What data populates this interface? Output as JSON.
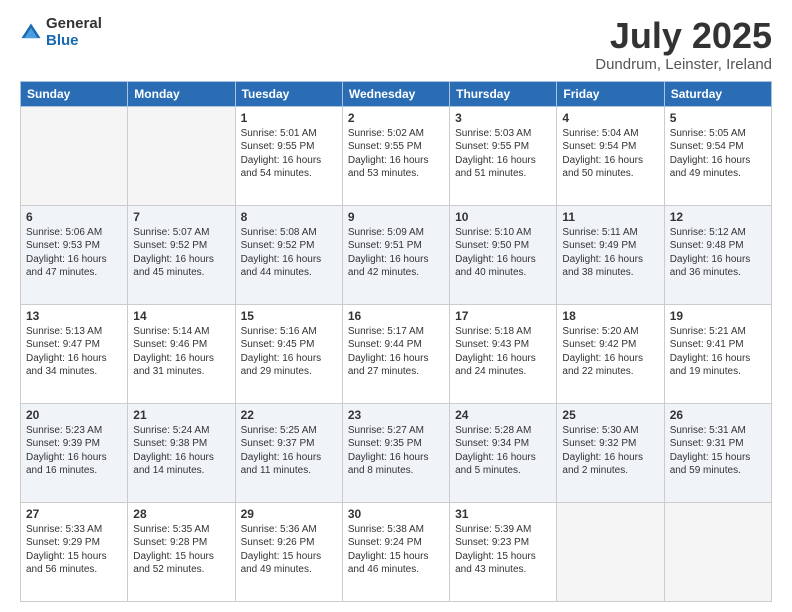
{
  "logo": {
    "general": "General",
    "blue": "Blue"
  },
  "title": "July 2025",
  "subtitle": "Dundrum, Leinster, Ireland",
  "weekdays": [
    "Sunday",
    "Monday",
    "Tuesday",
    "Wednesday",
    "Thursday",
    "Friday",
    "Saturday"
  ],
  "weeks": [
    [
      {
        "day": "",
        "info": ""
      },
      {
        "day": "",
        "info": ""
      },
      {
        "day": "1",
        "info": "Sunrise: 5:01 AM\nSunset: 9:55 PM\nDaylight: 16 hours\nand 54 minutes."
      },
      {
        "day": "2",
        "info": "Sunrise: 5:02 AM\nSunset: 9:55 PM\nDaylight: 16 hours\nand 53 minutes."
      },
      {
        "day": "3",
        "info": "Sunrise: 5:03 AM\nSunset: 9:55 PM\nDaylight: 16 hours\nand 51 minutes."
      },
      {
        "day": "4",
        "info": "Sunrise: 5:04 AM\nSunset: 9:54 PM\nDaylight: 16 hours\nand 50 minutes."
      },
      {
        "day": "5",
        "info": "Sunrise: 5:05 AM\nSunset: 9:54 PM\nDaylight: 16 hours\nand 49 minutes."
      }
    ],
    [
      {
        "day": "6",
        "info": "Sunrise: 5:06 AM\nSunset: 9:53 PM\nDaylight: 16 hours\nand 47 minutes."
      },
      {
        "day": "7",
        "info": "Sunrise: 5:07 AM\nSunset: 9:52 PM\nDaylight: 16 hours\nand 45 minutes."
      },
      {
        "day": "8",
        "info": "Sunrise: 5:08 AM\nSunset: 9:52 PM\nDaylight: 16 hours\nand 44 minutes."
      },
      {
        "day": "9",
        "info": "Sunrise: 5:09 AM\nSunset: 9:51 PM\nDaylight: 16 hours\nand 42 minutes."
      },
      {
        "day": "10",
        "info": "Sunrise: 5:10 AM\nSunset: 9:50 PM\nDaylight: 16 hours\nand 40 minutes."
      },
      {
        "day": "11",
        "info": "Sunrise: 5:11 AM\nSunset: 9:49 PM\nDaylight: 16 hours\nand 38 minutes."
      },
      {
        "day": "12",
        "info": "Sunrise: 5:12 AM\nSunset: 9:48 PM\nDaylight: 16 hours\nand 36 minutes."
      }
    ],
    [
      {
        "day": "13",
        "info": "Sunrise: 5:13 AM\nSunset: 9:47 PM\nDaylight: 16 hours\nand 34 minutes."
      },
      {
        "day": "14",
        "info": "Sunrise: 5:14 AM\nSunset: 9:46 PM\nDaylight: 16 hours\nand 31 minutes."
      },
      {
        "day": "15",
        "info": "Sunrise: 5:16 AM\nSunset: 9:45 PM\nDaylight: 16 hours\nand 29 minutes."
      },
      {
        "day": "16",
        "info": "Sunrise: 5:17 AM\nSunset: 9:44 PM\nDaylight: 16 hours\nand 27 minutes."
      },
      {
        "day": "17",
        "info": "Sunrise: 5:18 AM\nSunset: 9:43 PM\nDaylight: 16 hours\nand 24 minutes."
      },
      {
        "day": "18",
        "info": "Sunrise: 5:20 AM\nSunset: 9:42 PM\nDaylight: 16 hours\nand 22 minutes."
      },
      {
        "day": "19",
        "info": "Sunrise: 5:21 AM\nSunset: 9:41 PM\nDaylight: 16 hours\nand 19 minutes."
      }
    ],
    [
      {
        "day": "20",
        "info": "Sunrise: 5:23 AM\nSunset: 9:39 PM\nDaylight: 16 hours\nand 16 minutes."
      },
      {
        "day": "21",
        "info": "Sunrise: 5:24 AM\nSunset: 9:38 PM\nDaylight: 16 hours\nand 14 minutes."
      },
      {
        "day": "22",
        "info": "Sunrise: 5:25 AM\nSunset: 9:37 PM\nDaylight: 16 hours\nand 11 minutes."
      },
      {
        "day": "23",
        "info": "Sunrise: 5:27 AM\nSunset: 9:35 PM\nDaylight: 16 hours\nand 8 minutes."
      },
      {
        "day": "24",
        "info": "Sunrise: 5:28 AM\nSunset: 9:34 PM\nDaylight: 16 hours\nand 5 minutes."
      },
      {
        "day": "25",
        "info": "Sunrise: 5:30 AM\nSunset: 9:32 PM\nDaylight: 16 hours\nand 2 minutes."
      },
      {
        "day": "26",
        "info": "Sunrise: 5:31 AM\nSunset: 9:31 PM\nDaylight: 15 hours\nand 59 minutes."
      }
    ],
    [
      {
        "day": "27",
        "info": "Sunrise: 5:33 AM\nSunset: 9:29 PM\nDaylight: 15 hours\nand 56 minutes."
      },
      {
        "day": "28",
        "info": "Sunrise: 5:35 AM\nSunset: 9:28 PM\nDaylight: 15 hours\nand 52 minutes."
      },
      {
        "day": "29",
        "info": "Sunrise: 5:36 AM\nSunset: 9:26 PM\nDaylight: 15 hours\nand 49 minutes."
      },
      {
        "day": "30",
        "info": "Sunrise: 5:38 AM\nSunset: 9:24 PM\nDaylight: 15 hours\nand 46 minutes."
      },
      {
        "day": "31",
        "info": "Sunrise: 5:39 AM\nSunset: 9:23 PM\nDaylight: 15 hours\nand 43 minutes."
      },
      {
        "day": "",
        "info": ""
      },
      {
        "day": "",
        "info": ""
      }
    ]
  ]
}
